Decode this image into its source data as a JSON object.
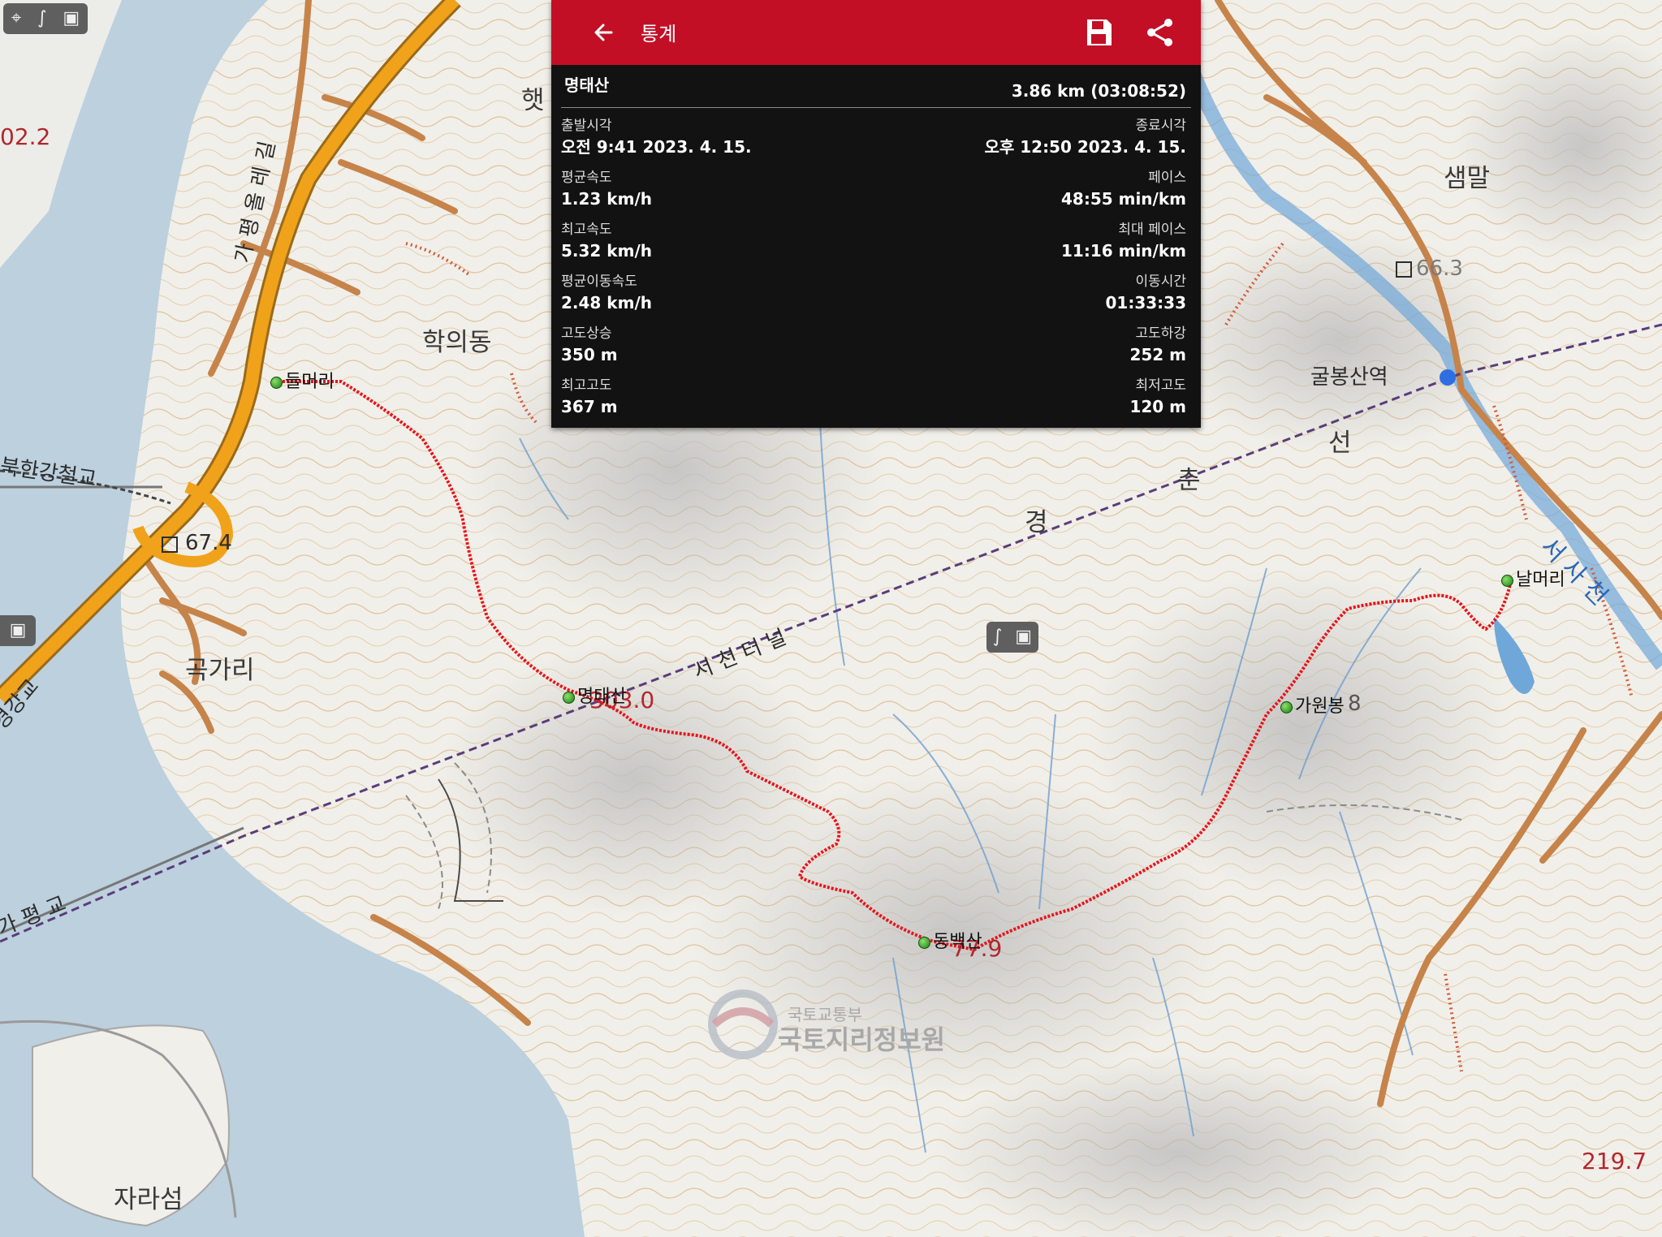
{
  "toolbar": {
    "back_icon": "arrow-left-icon",
    "title": "통계",
    "save_icon": "floppy-disk-icon",
    "share_icon": "share-icon"
  },
  "stats": {
    "track_name": "명태산",
    "distance_time": "3.86 km (03:08:52)",
    "rows": [
      {
        "left_label": "출발시각",
        "left_value": "오전 9:41 2023. 4. 15.",
        "right_label": "종료시각",
        "right_value": "오후 12:50 2023. 4. 15."
      },
      {
        "left_label": "평균속도",
        "left_value": "1.23 km/h",
        "right_label": "페이스",
        "right_value": "48:55 min/km"
      },
      {
        "left_label": "최고속도",
        "left_value": "5.32 km/h",
        "right_label": "최대 페이스",
        "right_value": "11:16 min/km"
      },
      {
        "left_label": "평균이동속도",
        "left_value": "2.48 km/h",
        "right_label": "이동시간",
        "right_value": "01:33:33"
      },
      {
        "left_label": "고도상승",
        "left_value": "350 m",
        "right_label": "고도하강",
        "right_value": "252 m"
      },
      {
        "left_label": "최고고도",
        "left_value": "367 m",
        "right_label": "최저고도",
        "right_value": "120 m"
      }
    ]
  },
  "map": {
    "place_names": {
      "haguidong": "학의동",
      "gokgari": "곡가리",
      "saemmal": "샘말",
      "jaraseom": "자라섬",
      "gulbong_station": "굴봉산역",
      "bukhangang_bridge": "북한강철교",
      "tunnel": "서 천 터 널",
      "gyeongchun_1": "경",
      "gyeongchun_2": "춘",
      "gyeongchun_3": "선",
      "seosacheon": "서 사 천",
      "gapyeong_bridge": "가 평 교",
      "gyeonggang_bridge": "경강교",
      "road_label": "가 평 올 레 길",
      "partial_hat": "햇",
      "logo_top": "국토교통부",
      "logo_bottom": "국토지리정보원"
    },
    "elevations": {
      "e1": "67.4",
      "e2": "66.3",
      "e3": "02.2",
      "e4": "303.0",
      "e5": "77.9",
      "e6": "219.7",
      "e7": "8"
    },
    "waypoints": [
      {
        "name": "들머리"
      },
      {
        "name": "명태산"
      },
      {
        "name": "동백산"
      },
      {
        "name": "가원봉"
      },
      {
        "name": "날머리"
      }
    ],
    "route_color": "#e8141b",
    "water_color": "#bcd0de",
    "road_color": "#d18a4c",
    "highway_color": "#f0a21a",
    "tool_icons": [
      "gps-locate-icon",
      "route-icon",
      "fullscreen-icon"
    ]
  }
}
